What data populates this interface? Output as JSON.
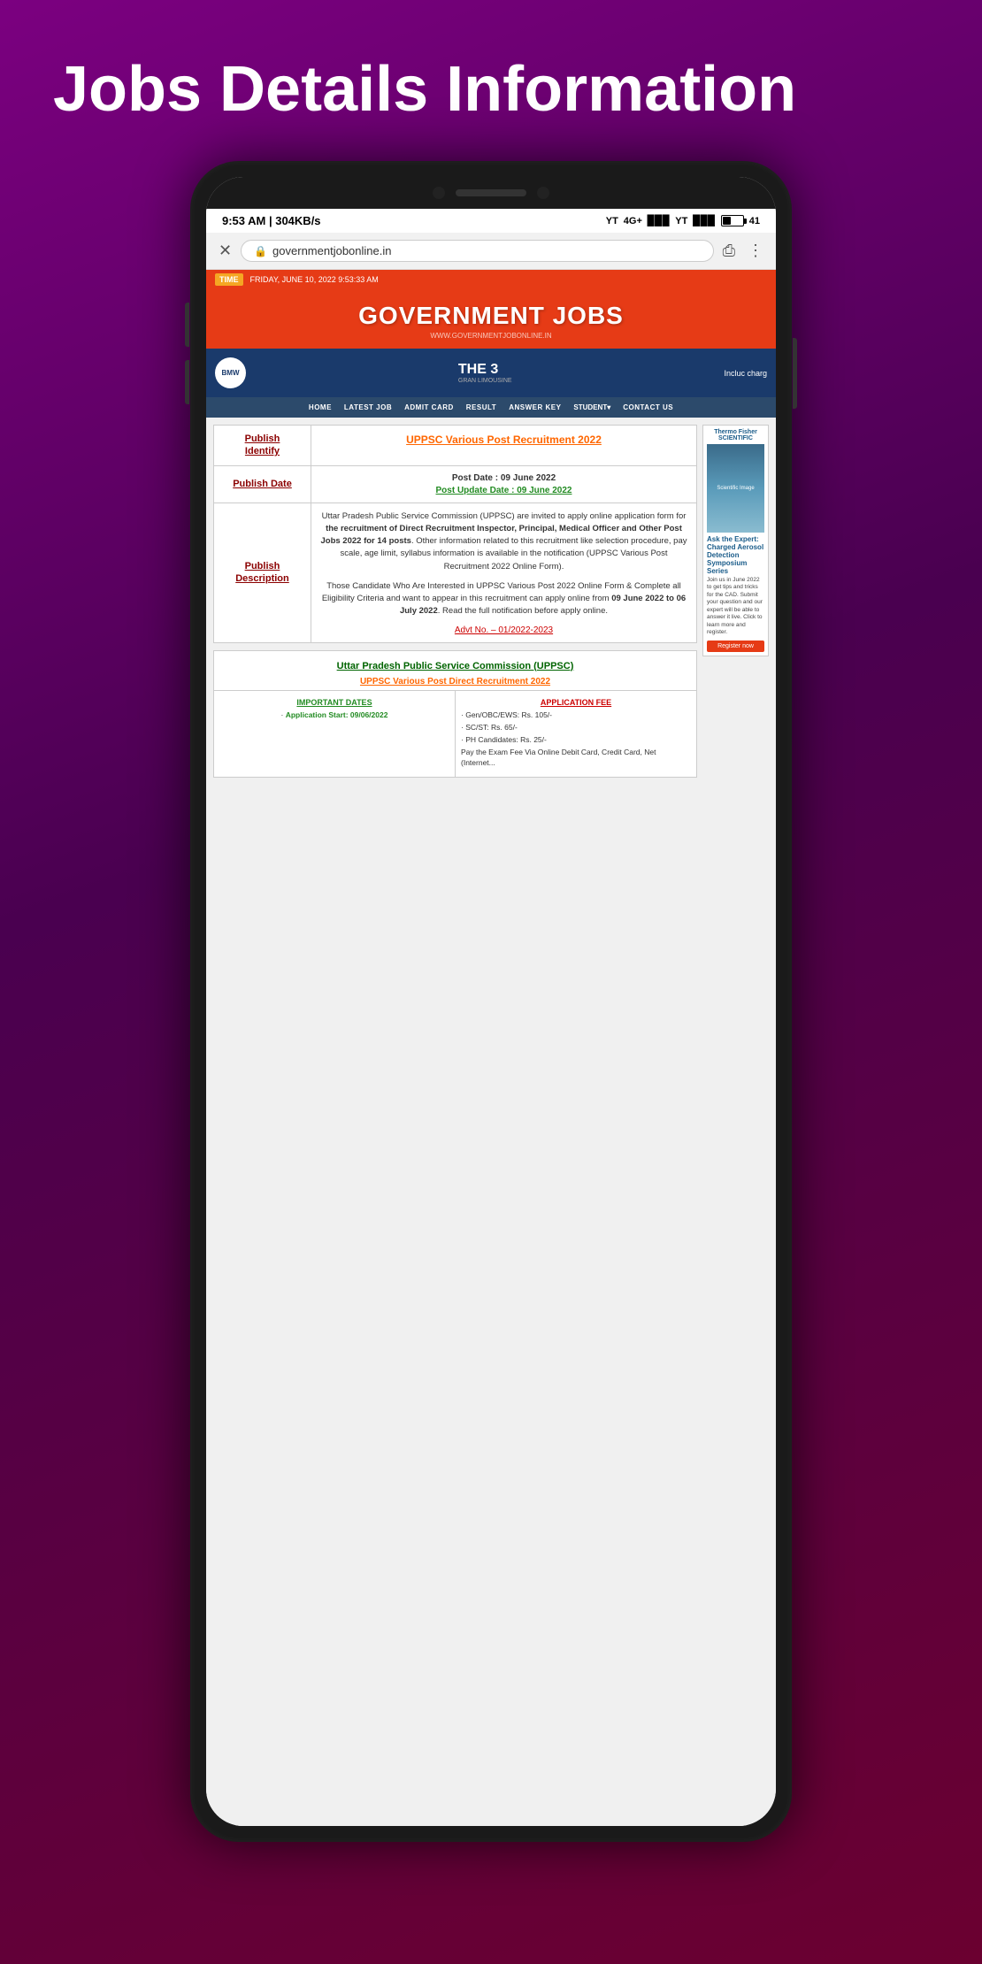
{
  "page": {
    "title": "Jobs Details Information"
  },
  "status_bar": {
    "time": "9:53 AM | 304KB/s",
    "battery": "41"
  },
  "browser": {
    "url": "governmentjobonline.in"
  },
  "site": {
    "ticker_label": "TIME",
    "ticker_text": "FRIDAY, JUNE 10, 2022 9:53:33 AM",
    "logo": "GOVERNMENT JOBS",
    "site_url": "WWW.GOVERNMENTJOBONLINE.IN",
    "ad_bmw": "THE 3",
    "ad_sub": "GRAN LIMOUSINE",
    "ad_right": "Incluc\ncharg"
  },
  "nav": {
    "items": [
      "HOME",
      "LATEST JOB",
      "ADMIT CARD",
      "RESULT",
      "ANSWER KEY",
      "STUDENT▾",
      "CONTACT US"
    ]
  },
  "card1": {
    "publish_identify_label": "Publish\nIdentify",
    "job_title": "UPPSC Various Post Recruitment\n2022",
    "publish_date_label": "Publish Date",
    "post_date": "Post Date : 09 June 2022",
    "update_date": "Post Update Date : 09 June 2022",
    "publish_description_label": "Publish\nDescription",
    "desc_para1": "Uttar Pradesh Public Service Commission (UPPSC) are invited to apply online application form for the recruitment of Direct Recruitment Inspector, Principal, Medical Officer and Other Post Jobs 2022 for 14 posts. Other information related to this recruitment like selection procedure, pay scale, age limit, syllabus information is available in the notification (UPPSC Various Post Recruitment 2022 Online Form).",
    "desc_para2": "Those Candidate Who Are Interested in UPPSC Various Post 2022 Online Form & Complete all Eligibility Criteria and want to appear in this recruitment can apply online from 09 June 2022 to 06 July 2022. Read the full notification before apply online.",
    "advt_no": "Advt No. – 01/2022-2023"
  },
  "card2": {
    "org_name": "Uttar Pradesh Public Service Commission\n(UPPSC)",
    "post_name": "UPPSC Various Post Direct Recruitment 2022",
    "important_dates_label": "IMPORTANT DATES",
    "app_start": "Application Start: 09/06/2022",
    "app_fee_label": "APPLICATION FEE",
    "fee_general": "Gen/OBC/EWS: Rs. 105/-",
    "fee_sc_st": "SC/ST: Rs. 65/-",
    "fee_ph": "PH Candidates: Rs. 25/-",
    "fee_pay": "Pay the Exam Fee Via Online Debit Card, Credit Card, Net (Internet..."
  },
  "sidebar_ad": {
    "brand": "Thermo\nFisher\nSCIENTIFIC",
    "title": "Ask the Expert: Charged Aerosol Detection Symposium Series",
    "body": "Join us in June 2022 to get tips and tricks for the CAD. Submit your question and our expert will be able to answer it live. Click to learn more and register.",
    "register_btn": "Register now"
  }
}
